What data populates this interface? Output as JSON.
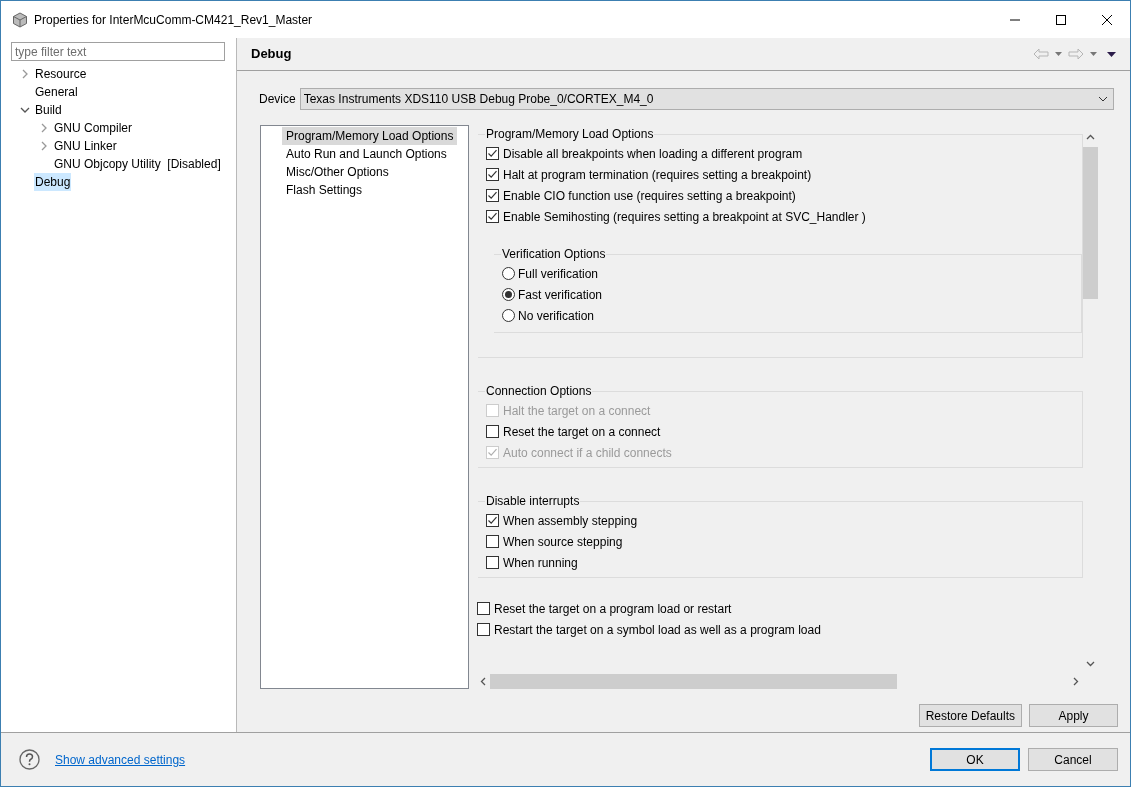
{
  "window": {
    "title": "Properties for InterMcuComm-CM421_Rev1_Master"
  },
  "sidebar": {
    "filter": {
      "placeholder": "type filter text"
    },
    "tree": [
      {
        "label": "Resource",
        "expanded": false,
        "selected": false
      },
      {
        "label": "General",
        "selected": false
      },
      {
        "label": "Build",
        "expanded": true,
        "selected": false,
        "children": [
          {
            "label": "GNU Compiler",
            "expanded": false,
            "selected": false
          },
          {
            "label": "GNU Linker",
            "expanded": false,
            "selected": false
          },
          {
            "label": "GNU Objcopy Utility  [Disabled]",
            "selected": false
          }
        ]
      },
      {
        "label": "Debug",
        "selected": true
      }
    ]
  },
  "page_title": "Debug",
  "device": {
    "label": "Device",
    "value": "Texas Instruments XDS110 USB Debug Probe_0/CORTEX_M4_0"
  },
  "categories": [
    {
      "label": "Program/Memory Load Options",
      "selected": true
    },
    {
      "label": "Auto Run and Launch Options",
      "selected": false
    },
    {
      "label": "Misc/Other Options",
      "selected": false
    },
    {
      "label": "Flash Settings",
      "selected": false
    }
  ],
  "groups": [
    {
      "title": "Program/Memory Load Options",
      "items": [
        {
          "kind": "checkbox",
          "label": "Disable all breakpoints when loading a different program",
          "checked": true,
          "disabled": false
        },
        {
          "kind": "checkbox",
          "label": "Halt at program termination (requires setting a breakpoint)",
          "checked": true,
          "disabled": false
        },
        {
          "kind": "checkbox",
          "label": "Enable CIO function use (requires setting a breakpoint)",
          "checked": true,
          "disabled": false
        },
        {
          "kind": "checkbox",
          "label": "Enable Semihosting (requires setting a breakpoint at SVC_Handler )",
          "checked": true,
          "disabled": false
        }
      ],
      "subgroup": {
        "title": "Verification Options",
        "items": [
          {
            "kind": "radio",
            "label": "Full verification",
            "selected": false
          },
          {
            "kind": "radio",
            "label": "Fast verification",
            "selected": true
          },
          {
            "kind": "radio",
            "label": "No verification",
            "selected": false
          }
        ]
      }
    },
    {
      "title": "Connection Options",
      "items": [
        {
          "kind": "checkbox",
          "label": "Halt the target on a connect",
          "checked": false,
          "disabled": true
        },
        {
          "kind": "checkbox",
          "label": "Reset the target on a connect",
          "checked": false,
          "disabled": false
        },
        {
          "kind": "checkbox",
          "label": "Auto connect if a child connects",
          "checked": true,
          "disabled": true
        }
      ]
    },
    {
      "title": "Disable interrupts",
      "items": [
        {
          "kind": "checkbox",
          "label": "When assembly stepping",
          "checked": true,
          "disabled": false
        },
        {
          "kind": "checkbox",
          "label": "When source stepping",
          "checked": false,
          "disabled": false
        },
        {
          "kind": "checkbox",
          "label": "When running",
          "checked": false,
          "disabled": false
        }
      ]
    }
  ],
  "loose_options": [
    {
      "kind": "checkbox",
      "label": "Reset the target on a program load or restart",
      "checked": false,
      "disabled": false
    },
    {
      "kind": "checkbox",
      "label": "Restart the target on a symbol load as well as a program load",
      "checked": false,
      "disabled": false
    }
  ],
  "page_buttons": [
    "Restore Defaults",
    "Apply"
  ],
  "footer": {
    "link": "Show advanced settings",
    "buttons": [
      {
        "label": "OK",
        "default": true
      },
      {
        "label": "Cancel",
        "default": false
      }
    ]
  }
}
